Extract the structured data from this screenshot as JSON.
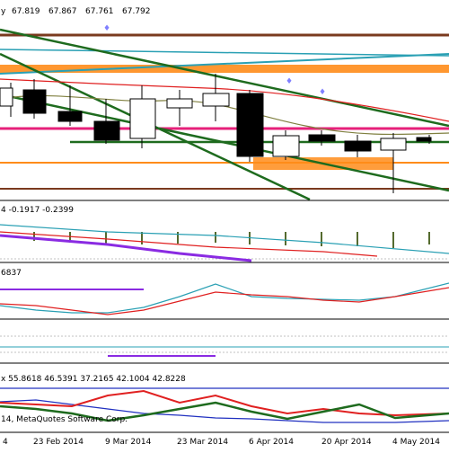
{
  "chart": {
    "symbol_suffix": "y",
    "ohlc": {
      "open": "67.819",
      "high": "67.867",
      "low": "67.761",
      "close": "67.792"
    },
    "colors": {
      "background": "#ffffff",
      "candle_outline": "#000000",
      "bull_fill": "#ffffff",
      "bear_fill": "#000000",
      "dark_line": "#1e6b1e",
      "teal_line": "#2aa0b4",
      "orange_band": "#ff8c1a",
      "magenta_line": "#e6207a",
      "brown_line": "#7a3a1e",
      "red_line": "#e02020",
      "purple_line": "#8a2be2",
      "blue_line": "#2030c0",
      "olive_line": "#808040"
    }
  },
  "indicator_1": {
    "values_text": "4 -0.1917 -0.2399"
  },
  "indicator_2": {
    "values_text": "6837"
  },
  "indicator_4": {
    "values_text": "x 55.8618 46.5391 37.2165 42.1004 42.8228"
  },
  "footer": {
    "copyright_text": "14, MetaQuotes Software Corp."
  },
  "time_axis": {
    "labels": [
      "4",
      "23 Feb 2014",
      "9 Mar 2014",
      "23 Mar 2014",
      "6 Apr 2014",
      "20 Apr 2014",
      "4 May 2014"
    ]
  },
  "chart_data": {
    "type": "candlestick",
    "title": "",
    "x": [
      "4",
      "23 Feb 2014",
      "9 Mar 2014",
      "23 Mar 2014",
      "6 Apr 2014",
      "20 Apr 2014",
      "4 May 2014"
    ],
    "latest_bar": {
      "open": 67.819,
      "high": 67.867,
      "low": 67.761,
      "close": 67.792
    },
    "indicator_1_values": [
      -0.1917,
      -0.2399
    ],
    "indicator_4_values": [
      55.8618,
      46.5391,
      37.2165,
      42.1004,
      42.8228
    ]
  }
}
